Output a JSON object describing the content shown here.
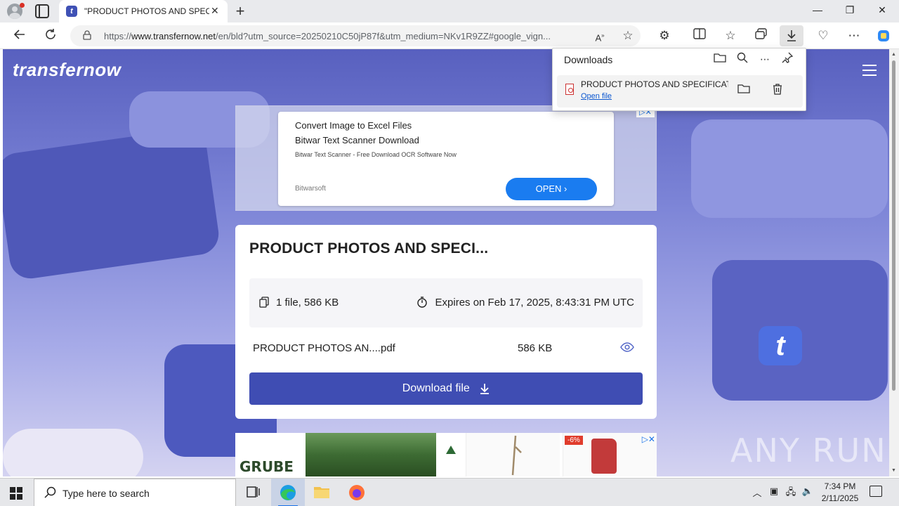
{
  "browser": {
    "tab_title": "\"PRODUCT PHOTOS AND SPECIFI",
    "tab_close": "✕",
    "new_tab": "+",
    "url_prefix": "https://",
    "url_domain": "www.transfernow.net",
    "url_rest": "/en/bld?utm_source=20250210C50jP87f&utm_medium=NKv1R9ZZ#google_vign...",
    "window_min": "—",
    "window_max": "❐",
    "window_close": "✕"
  },
  "downloads_panel": {
    "title": "Downloads",
    "item_name": "PRODUCT PHOTOS AND SPECIFICATION",
    "item_action": "Open file"
  },
  "page": {
    "logo": "transfernow",
    "ad_top": {
      "line1": "Convert Image to Excel Files",
      "line2": "Bitwar Text Scanner Download",
      "line3": "Bitwar Text Scanner - Free Download OCR Software Now",
      "brand": "Bitwarsoft",
      "cta": "OPEN ›",
      "adchoices": "▷✕"
    },
    "card": {
      "title": "PRODUCT PHOTOS AND SPECI...",
      "files_summary": "1 file, 586 KB",
      "expires": "Expires on Feb 17, 2025, 8:43:31 PM UTC",
      "file_name": "PRODUCT PHOTOS AN....pdf",
      "file_size": "586 KB",
      "download_label": "Download file"
    },
    "ad_bottom": {
      "brand": "GRUBE",
      "discount": "-6%",
      "close": "▷✕"
    },
    "watermark": "ANY RUN"
  },
  "taskbar": {
    "search_placeholder": "Type here to search",
    "time": "7:34 PM",
    "date": "2/11/2025"
  },
  "colors": {
    "accent": "#3f4db3",
    "ad_button": "#1a7cf0",
    "page_bg": "#6a71cc"
  }
}
